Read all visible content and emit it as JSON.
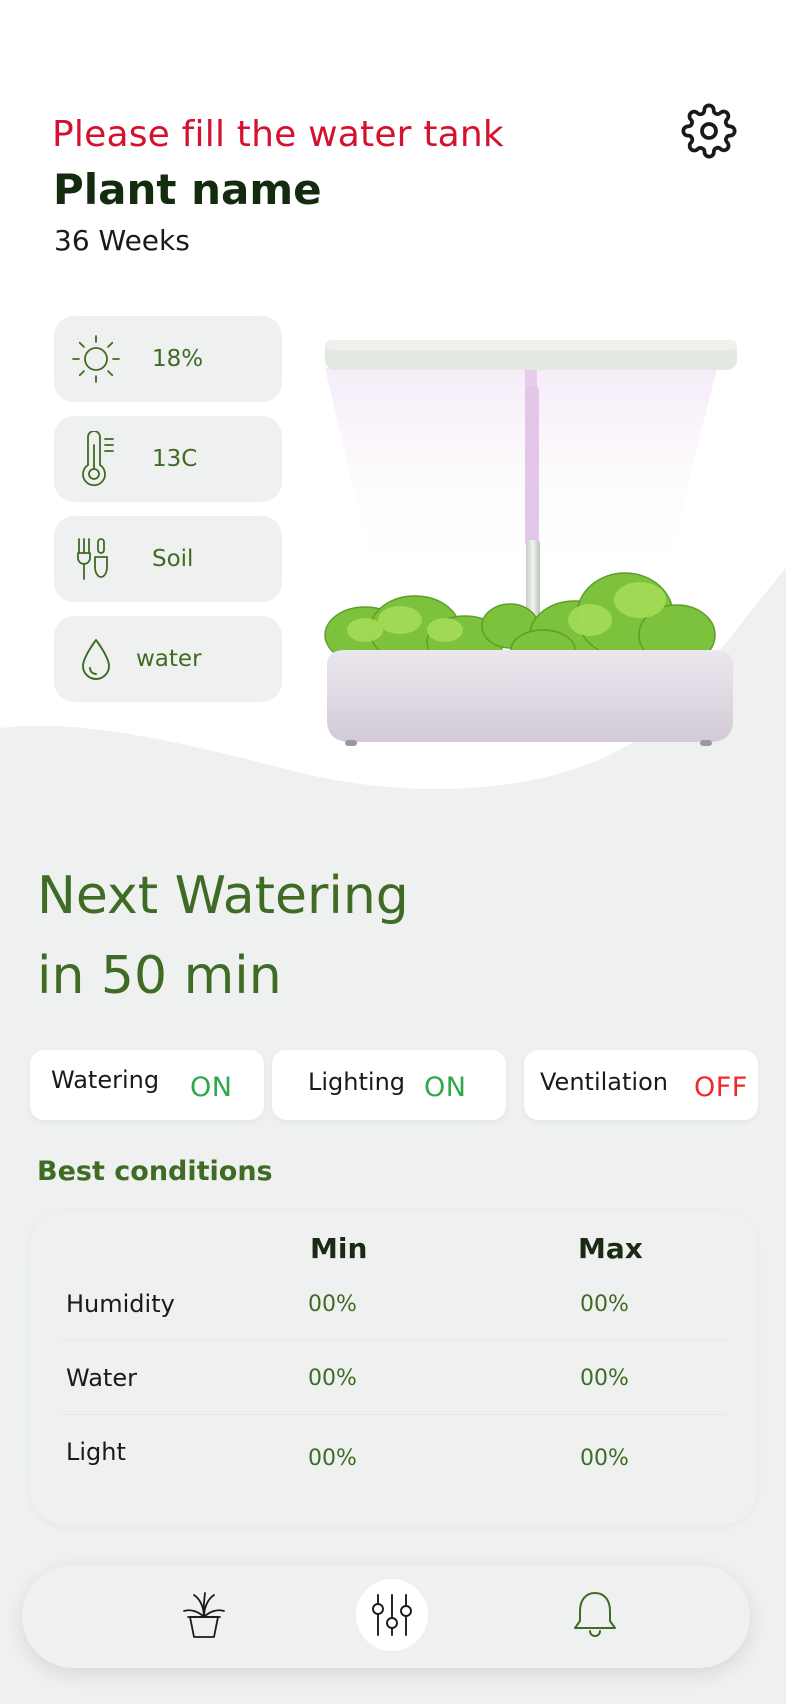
{
  "header": {
    "alert": "Please fill the water tank",
    "plant_name": "Plant name",
    "age": "36 Weeks"
  },
  "stats": [
    {
      "icon": "sun-icon",
      "value": "18%"
    },
    {
      "icon": "thermometer-icon",
      "value": "13C"
    },
    {
      "icon": "garden-tools-icon",
      "value": "Soil"
    },
    {
      "icon": "water-drop-icon",
      "value": "water"
    }
  ],
  "next_watering": {
    "line1": "Next Watering",
    "line2": "in 50 min"
  },
  "toggles": [
    {
      "label": "Watering",
      "state": "ON"
    },
    {
      "label": "Lighting",
      "state": "ON"
    },
    {
      "label": "Ventilation",
      "state": "OFF"
    }
  ],
  "best_conditions": {
    "title": "Best conditions",
    "headers": {
      "min": "Min",
      "max": "Max"
    },
    "rows": [
      {
        "label": "Humidity",
        "min": "00%",
        "max": "00%"
      },
      {
        "label": "Water",
        "min": "00%",
        "max": "00%"
      },
      {
        "label": "Light",
        "min": "00%",
        "max": "00%"
      }
    ]
  },
  "nav": {
    "items": [
      {
        "icon": "potted-plant-icon",
        "active": false
      },
      {
        "icon": "sliders-icon",
        "active": true
      },
      {
        "icon": "bell-icon",
        "active": false
      }
    ]
  },
  "colors": {
    "alert": "#d4112e",
    "accent_green": "#3f6b24",
    "on": "#2fa84a",
    "off": "#ee2a2a",
    "panel": "#eef1f0"
  }
}
